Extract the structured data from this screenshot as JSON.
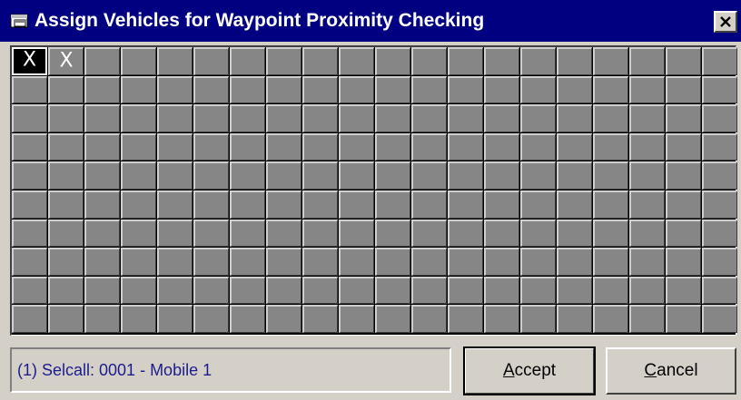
{
  "window": {
    "title": "Assign Vehicles for Waypoint Proximity Checking",
    "icon": "window-app-icon",
    "close_icon": "close-icon"
  },
  "grid": {
    "columns": 20,
    "rows": 10,
    "cells": [
      {
        "row": 1,
        "col": 1,
        "mark": "X",
        "selected": true
      },
      {
        "row": 1,
        "col": 2,
        "mark": "X",
        "selected": false
      }
    ]
  },
  "status": {
    "text": "(1) Selcall: 0001 - Mobile 1"
  },
  "buttons": {
    "accept": {
      "accel": "A",
      "rest": "ccept"
    },
    "cancel": {
      "accel": "C",
      "rest": "ancel"
    }
  },
  "colors": {
    "titlebar": "#000080",
    "cell": "#868686",
    "status_text": "#1c1c8e"
  }
}
